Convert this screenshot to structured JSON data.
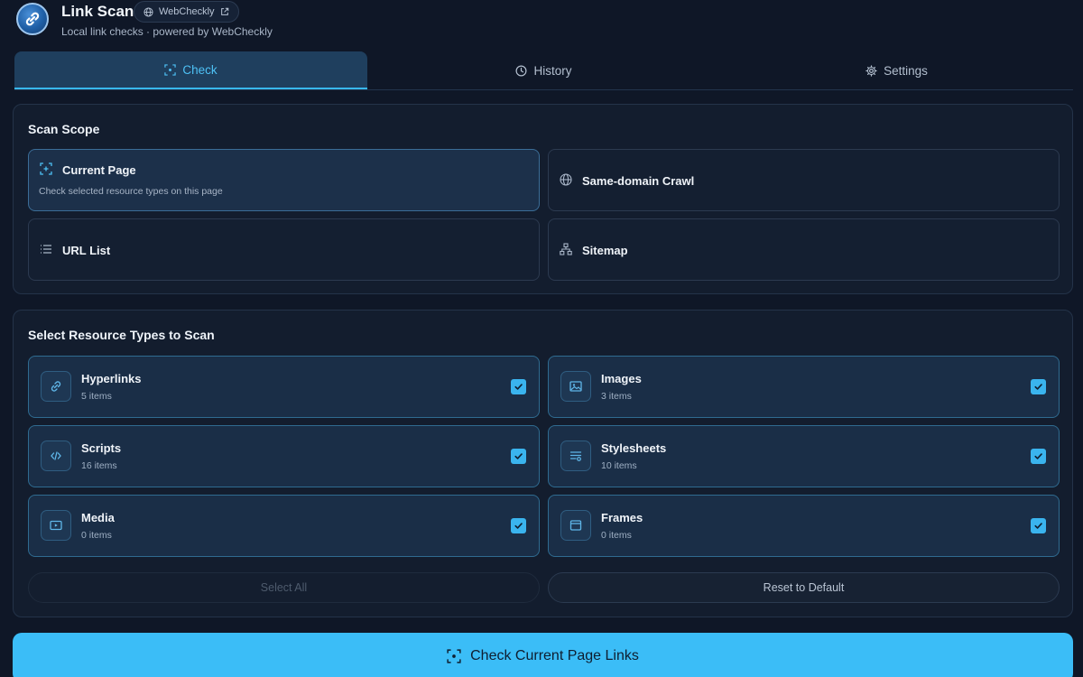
{
  "header": {
    "title": "Link Scan",
    "subtitle": "Local link checks · powered by WebCheckly",
    "brand_badge": "WebCheckly"
  },
  "tabs": [
    {
      "label": "Check",
      "icon": "scan-icon",
      "active": true
    },
    {
      "label": "History",
      "icon": "clock-icon",
      "active": false
    },
    {
      "label": "Settings",
      "icon": "gear-icon",
      "active": false
    }
  ],
  "scope": {
    "title": "Scan Scope",
    "options": [
      {
        "label": "Current Page",
        "desc": "Check selected resource types on this page",
        "icon": "scan-icon",
        "selected": true
      },
      {
        "label": "Same-domain Crawl",
        "icon": "globe-icon",
        "selected": false
      },
      {
        "label": "URL List",
        "icon": "list-icon",
        "selected": false
      },
      {
        "label": "Sitemap",
        "icon": "sitemap-icon",
        "selected": false
      }
    ]
  },
  "resources": {
    "title": "Select Resource Types to Scan",
    "items": [
      {
        "name": "Hyperlinks",
        "count": "5 items",
        "icon": "link-icon",
        "checked": true
      },
      {
        "name": "Images",
        "count": "3 items",
        "icon": "image-icon",
        "checked": true
      },
      {
        "name": "Scripts",
        "count": "16 items",
        "icon": "code-icon",
        "checked": true
      },
      {
        "name": "Stylesheets",
        "count": "10 items",
        "icon": "stylesheet-icon",
        "checked": true
      },
      {
        "name": "Media",
        "count": "0 items",
        "icon": "media-icon",
        "checked": true
      },
      {
        "name": "Frames",
        "count": "0 items",
        "icon": "frame-icon",
        "checked": true
      }
    ],
    "select_all": "Select All",
    "reset": "Reset to Default"
  },
  "primary_action": "Check Current Page Links",
  "colors": {
    "background": "#0f1727",
    "accent": "#3bbdf7",
    "active_tab": "#4ec1f5"
  }
}
